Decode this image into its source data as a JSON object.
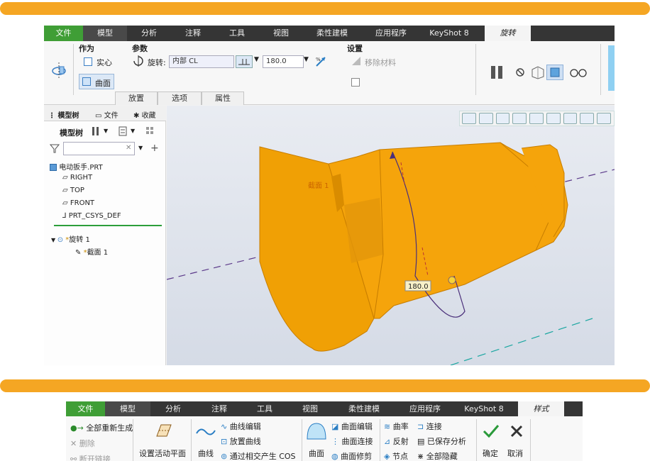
{
  "colors": {
    "band": "#f5a623",
    "file_tab": "#3f9e36",
    "tabbar": "#353535",
    "part": "#f5a40b",
    "accent_blue": "#3c7fc4"
  },
  "top": {
    "tabs": [
      "文件",
      "模型",
      "分析",
      "注释",
      "工具",
      "视图",
      "柔性建模",
      "应用程序",
      "KeyShot 8"
    ],
    "active_tab": "旋转",
    "ribbon": {
      "as_label": "作为",
      "solid_label": "实心",
      "surface_label": "曲面",
      "params_label": "参数",
      "rotate_label": "旋转:",
      "axis_value": "内部 CL",
      "angle_value": "180.0",
      "settings_label": "设置",
      "remove_material_label": "移除材料"
    },
    "sub_tabs": [
      "放置",
      "选项",
      "属性"
    ],
    "tree_tabs": [
      "模型树",
      "文件",
      "收藏"
    ],
    "tree_toolbar_label": "模型树",
    "filter_placeholder": "",
    "tree": {
      "part": "电动扳手.PRT",
      "datums": [
        "RIGHT",
        "TOP",
        "FRONT",
        "PRT_CSYS_DEF"
      ],
      "feature": "旋转 1",
      "sketch": "截面 1"
    },
    "viewport": {
      "section_label": "截面 1",
      "angle_readout": "180.0"
    }
  },
  "bottom": {
    "tabs": [
      "文件",
      "模型",
      "分析",
      "注释",
      "工具",
      "视图",
      "柔性建模",
      "应用程序",
      "KeyShot 8"
    ],
    "active_tab": "样式",
    "ribbon": {
      "regen_all": "全部重新生成",
      "delete": "删除",
      "break_link": "断开链接",
      "set_active_plane": "设置活动平面",
      "curve": "曲线",
      "curve_edit": "曲线编辑",
      "place_curve": "放置曲线",
      "cos_intersect": "通过相交产生 COS",
      "surface": "曲面",
      "surface_edit": "曲面编辑",
      "surface_connect": "曲面连接",
      "surface_trim": "曲面修剪",
      "curvature": "曲率",
      "connect": "连接",
      "reflect": "反射",
      "saved_analysis": "已保存分析",
      "node": "节点",
      "hide_all": "全部隐藏",
      "ok": "确定",
      "cancel": "取消"
    }
  }
}
